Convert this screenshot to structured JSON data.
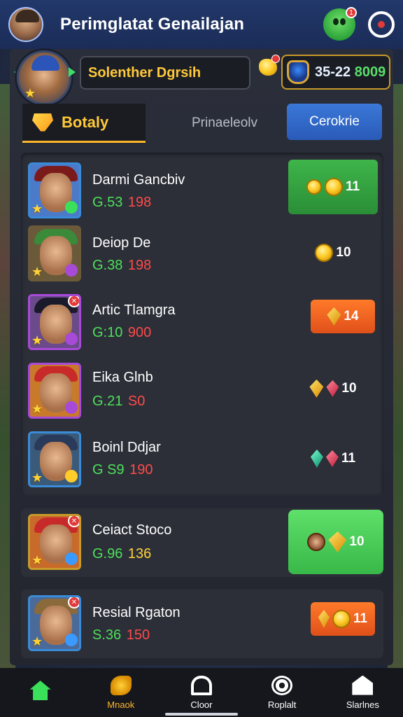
{
  "header": {
    "title": "Perimglatat Genailajan",
    "notification_count": "1"
  },
  "player": {
    "name": "Solenther Dgrsih",
    "currency_a": "35-22",
    "currency_b": "8009"
  },
  "tabs": {
    "active": "Botaly",
    "middle": "Prinaeleolv",
    "button": "Cerokrie"
  },
  "list": [
    {
      "name": "Darmi Gancbiv",
      "stat_a": "G.53",
      "stat_b": "198",
      "reward": "11"
    },
    {
      "name": "Deiop De",
      "stat_a": "G.38",
      "stat_b": "198",
      "reward": "10"
    },
    {
      "name": "Artic Tlamgra",
      "stat_a": "G:10",
      "stat_b": "900",
      "reward": "14"
    },
    {
      "name": "Eika Glnb",
      "stat_a": "G.21",
      "stat_b": "S0",
      "reward": "10"
    },
    {
      "name": "Boinl Ddjar",
      "stat_a": "G S9",
      "stat_b": "190",
      "reward": "11"
    }
  ],
  "featured": [
    {
      "name": "Ceiact Stoco",
      "stat_a": "G.96",
      "stat_b": "136",
      "reward": "10"
    },
    {
      "name": "Resial Rgaton",
      "stat_a": "S.36",
      "stat_b": "150",
      "reward": "11"
    }
  ],
  "nav": {
    "items": [
      {
        "label": ""
      },
      {
        "label": "Mnaok"
      },
      {
        "label": "Cloor"
      },
      {
        "label": "Roplalt"
      },
      {
        "label": "Slarlnes"
      }
    ]
  }
}
